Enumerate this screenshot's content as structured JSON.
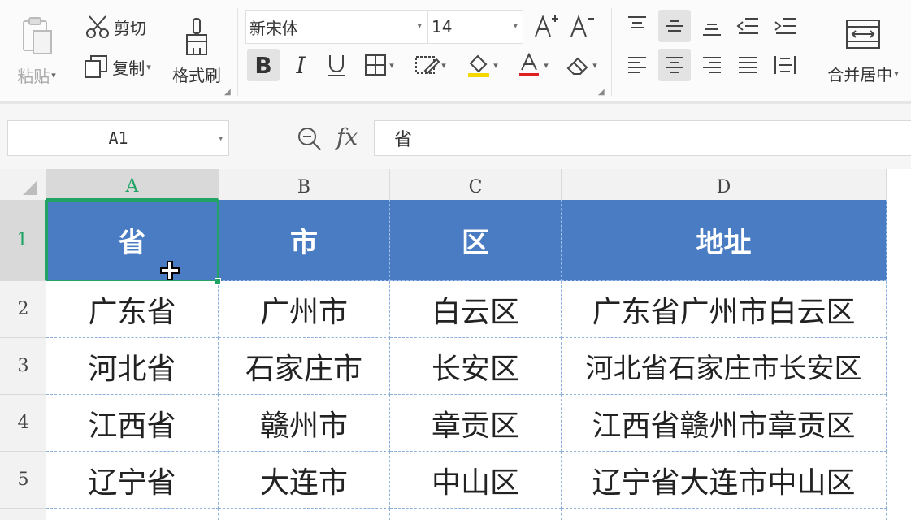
{
  "ribbon": {
    "paste_label": "粘贴",
    "cut_label": "剪切",
    "copy_label": "复制",
    "format_painter_label": "格式刷",
    "font_name": "新宋体",
    "font_size": "14",
    "merge_center_label": "合并居中"
  },
  "formula_bar": {
    "cell_ref": "A1",
    "fx_label": "fx",
    "formula_value": "省"
  },
  "sheet": {
    "columns": [
      "A",
      "B",
      "C",
      "D"
    ],
    "rows": [
      "1",
      "2",
      "3",
      "4",
      "5"
    ],
    "header": [
      "省",
      "市",
      "区",
      "地址"
    ],
    "data": [
      [
        "广东省",
        "广州市",
        "白云区",
        "广东省广州市白云区"
      ],
      [
        "河北省",
        "石家庄市",
        "长安区",
        "河北省石家庄市长安区"
      ],
      [
        "江西省",
        "赣州市",
        "章贡区",
        "江西省赣州市章贡区"
      ],
      [
        "辽宁省",
        "大连市",
        "中山区",
        "辽宁省大连市中山区"
      ]
    ],
    "header_fill": "#4a7cc3",
    "selection_color": "#21a366"
  }
}
